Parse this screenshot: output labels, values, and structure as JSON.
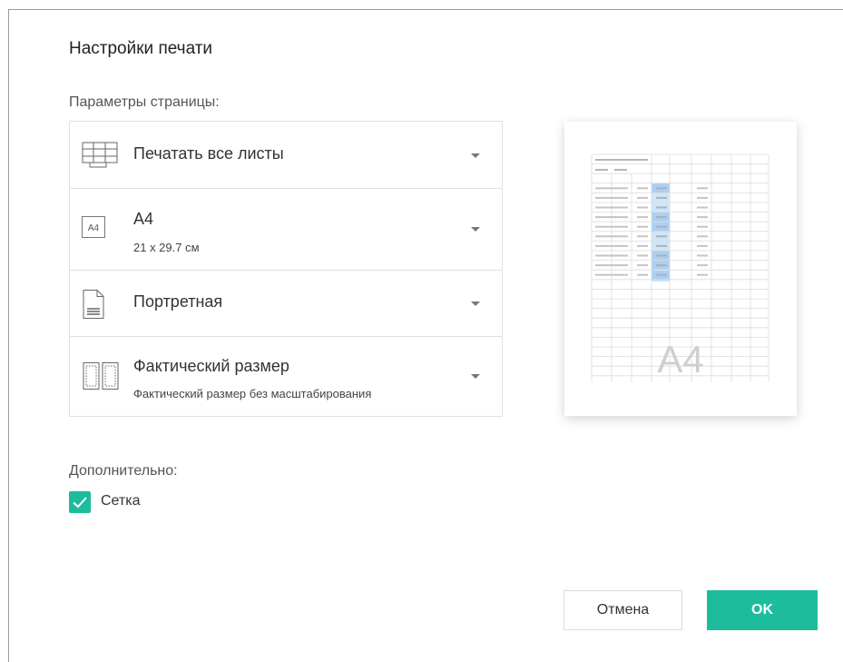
{
  "dialog": {
    "title": "Настройки печати",
    "page_params_label": "Параметры страницы:",
    "additional_label": "Дополнительно:"
  },
  "options": {
    "sheets": {
      "label": "Печатать все листы",
      "icon": "sheets-table-icon"
    },
    "paper": {
      "label": "A4",
      "sublabel": "21 x 29.7 см",
      "icon": "paper-size-a4-icon",
      "icon_text": "A4"
    },
    "orientation": {
      "label": "Портретная",
      "icon": "portrait-page-icon"
    },
    "scaling": {
      "label": "Фактический размер",
      "sublabel": "Фактический размер без масштабирования",
      "icon": "actual-size-icon"
    }
  },
  "preview": {
    "watermark": "A4"
  },
  "grid_checkbox": {
    "label": "Сетка",
    "checked": true
  },
  "buttons": {
    "cancel": "Отмена",
    "ok": "OK"
  },
  "colors": {
    "accent": "#1dbc9c",
    "highlight_cells": "#a9d0f5"
  }
}
